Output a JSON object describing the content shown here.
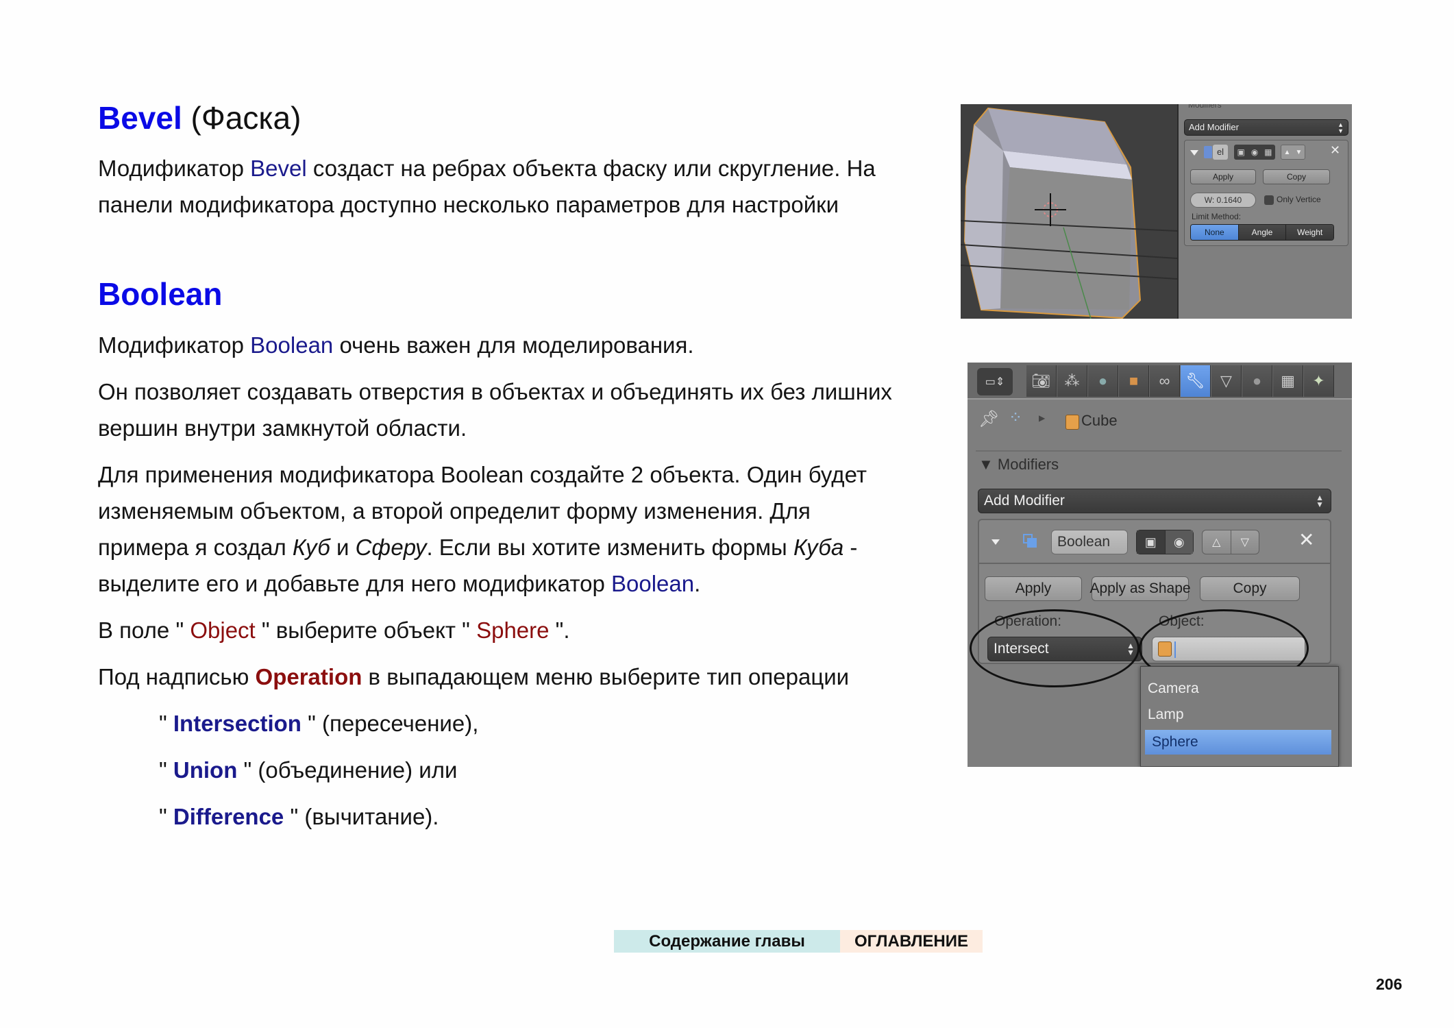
{
  "bevel": {
    "heading_keyword": "Bevel",
    "heading_rest": " (Фаска)",
    "para": {
      "l1_a": "Модификатор ",
      "l1_kw": "Bevel",
      "l1_b": " создаст на ребрах объекта фаску или скругление. На",
      "l2": "панели модификатора доступно несколько параметров для настройки"
    },
    "screenshot": {
      "panel_header": "Modifiers",
      "add_modifier": "Add Modifier",
      "name_field": "el",
      "apply": "Apply",
      "copy": "Copy",
      "width_field": "W: 0.1640",
      "only_vertices": "Only Vertice",
      "limit_method_label": "Limit Method:",
      "limit_methods": [
        "None",
        "Angle",
        "Weight"
      ],
      "limit_method_selected": "None"
    }
  },
  "boolean": {
    "heading": "Boolean",
    "p1_a": "Модификатор ",
    "p1_kw": "Boolean",
    "p1_b": " очень важен для моделирования.",
    "p2_l1": "Он позволяет создавать отверстия в объектах и объединять их без лишних",
    "p2_l2": "вершин внутри замкнутой области.",
    "p3_l1": "Для применения модификатора Boolean создайте 2 объекта. Один будет",
    "p3_l2": "изменяемым объектом, а второй определит форму изменения. Для",
    "p3_l3_a": "примера я создал ",
    "p3_l3_i1": "Куб",
    "p3_l3_b": " и ",
    "p3_l3_i2": "Сферу",
    "p3_l3_c": ". Если вы хотите изменить формы ",
    "p3_l3_i3": "Куба",
    "p3_l3_d": " -",
    "p3_l4_a": "выделите его и добавьте для него модификатор ",
    "p3_l4_kw": "Boolean",
    "p3_l4_b": ".",
    "p4_a": "В поле \" ",
    "p4_kw1": "Object",
    "p4_b": " \" выберите объект \" ",
    "p4_kw2": "Sphere",
    "p4_c": " \".",
    "p5_a": "Под надписью ",
    "p5_kw": "Operation",
    "p5_b": " в выпадающем меню выберите тип операции",
    "operations": [
      {
        "name": "Intersection",
        "desc": " \" (пересечение),"
      },
      {
        "name": "Union",
        "desc": " \" (объединение) или"
      },
      {
        "name": "Difference",
        "desc": " \" (вычитание)."
      }
    ],
    "quote_open": "\" ",
    "screenshot": {
      "tabs": [
        "render",
        "scene",
        "world",
        "object",
        "constraints",
        "modifiers",
        "data",
        "material",
        "texture",
        "particles"
      ],
      "active_tab": "modifiers",
      "breadcrumb_object": "Cube",
      "panel_header": "Modifiers",
      "add_modifier": "Add Modifier",
      "modifier_name": "Boolean",
      "apply": "Apply",
      "apply_as_shape": "Apply as Shape",
      "copy": "Copy",
      "operation_label": "Operation:",
      "operation_value": "Intersect",
      "object_label": "Object:",
      "object_value": "",
      "object_menu": [
        "Camera",
        "Lamp",
        "Sphere"
      ],
      "object_menu_highlighted": "Sphere"
    }
  },
  "footer": {
    "chapter_contents": "Содержание главы",
    "toc": "ОГЛАВЛЕНИЕ",
    "page_number": "206"
  }
}
